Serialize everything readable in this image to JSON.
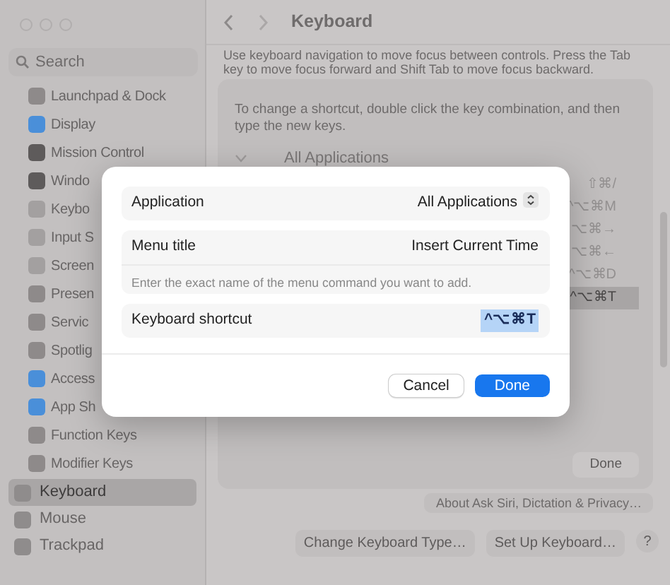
{
  "window": {
    "title": "Keyboard"
  },
  "sidebar": {
    "search": {
      "placeholder": "Search"
    },
    "items": [
      {
        "label": "Launchpad & Dock",
        "color": "#8e8a8a"
      },
      {
        "label": "Display",
        "color": "#4a8fd9"
      },
      {
        "label": "Mission Control",
        "color": "#5e5b5b"
      },
      {
        "label": "Windo",
        "color": "#5e5b5b"
      },
      {
        "label": "Keybo",
        "color": "#a3a0a0"
      },
      {
        "label": "Input S",
        "color": "#a3a0a0"
      },
      {
        "label": "Screen",
        "color": "#a3a0a0"
      },
      {
        "label": "Presen",
        "color": "#8e8a8a"
      },
      {
        "label": "Servic",
        "color": "#8e8a8a"
      },
      {
        "label": "Spotlig",
        "color": "#8e8a8a"
      },
      {
        "label": "Access",
        "color": "#4a8fd9"
      },
      {
        "label": "App Sh",
        "color": "#4a8fd9"
      },
      {
        "label": "Function Keys",
        "color": "#8e8a8a"
      },
      {
        "label": "Modifier Keys",
        "color": "#8e8a8a"
      }
    ],
    "bottom_items": [
      {
        "label": "Keyboard",
        "selected": true
      },
      {
        "label": "Mouse",
        "selected": false
      },
      {
        "label": "Trackpad",
        "selected": false
      }
    ]
  },
  "content": {
    "intro": "Use keyboard navigation to move focus between controls. Press the Tab key to move focus forward and Shift Tab to move focus backward.",
    "sheet": {
      "instructions": "To change a shortcut, double click the key combination, and then type the new keys.",
      "group": "All Applications",
      "expanded": true,
      "shortcuts": [
        {
          "keys": "⇧⌘/",
          "selected": false
        },
        {
          "keys": "^⌥⌘M",
          "selected": false
        },
        {
          "keys": "⌥⌘→",
          "selected": false
        },
        {
          "keys": "⌥⌘←",
          "selected": false
        },
        {
          "keys": "^⌥⌘D",
          "selected": false
        },
        {
          "keys": "^⌥⌘T",
          "selected": true
        }
      ],
      "done_button": "Done"
    },
    "about_button": "About Ask Siri, Dictation & Privacy…",
    "buttons": [
      "Change Keyboard Type…",
      "Set Up Keyboard…"
    ],
    "help_button": "?"
  },
  "dialog": {
    "application": {
      "label": "Application",
      "value": "All Applications"
    },
    "menu_title": {
      "label": "Menu title",
      "value": "Insert Current Time",
      "hint": "Enter the exact name of the menu command you want to add."
    },
    "shortcut": {
      "label": "Keyboard shortcut",
      "value": "^⌥⌘T"
    },
    "buttons": [
      {
        "label": "Cancel",
        "kind": "secondary"
      },
      {
        "label": "Done",
        "kind": "primary"
      }
    ]
  }
}
